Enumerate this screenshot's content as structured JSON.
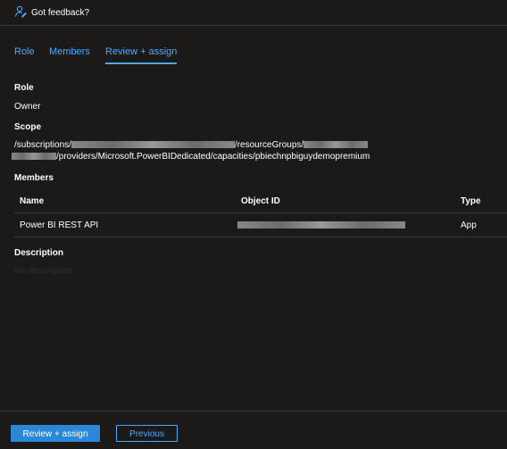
{
  "feedback": {
    "label": "Got feedback?",
    "icon": "feedback-person-icon"
  },
  "tabs": [
    {
      "label": "Role",
      "active": false
    },
    {
      "label": "Members",
      "active": false
    },
    {
      "label": "Review + assign",
      "active": true
    }
  ],
  "role": {
    "heading": "Role",
    "value": "Owner"
  },
  "scope": {
    "heading": "Scope",
    "line1_prefix": "/subscriptions/",
    "line1_mid": "/resourceGroups/",
    "line2_suffix": "/providers/Microsoft.PowerBIDedicated/capacities/pbiechnpbiguydemopremium"
  },
  "members": {
    "heading": "Members",
    "columns": {
      "name": "Name",
      "object_id": "Object ID",
      "type": "Type"
    },
    "rows": [
      {
        "name": "Power BI REST API",
        "object_id": "",
        "type": "App"
      }
    ]
  },
  "description": {
    "heading": "Description",
    "value": "No description"
  },
  "footer": {
    "primary_label": "Review + assign",
    "secondary_label": "Previous"
  },
  "colors": {
    "accent": "#4fa8ff",
    "primary_button": "#2b88d8",
    "background": "#1b1a19"
  }
}
